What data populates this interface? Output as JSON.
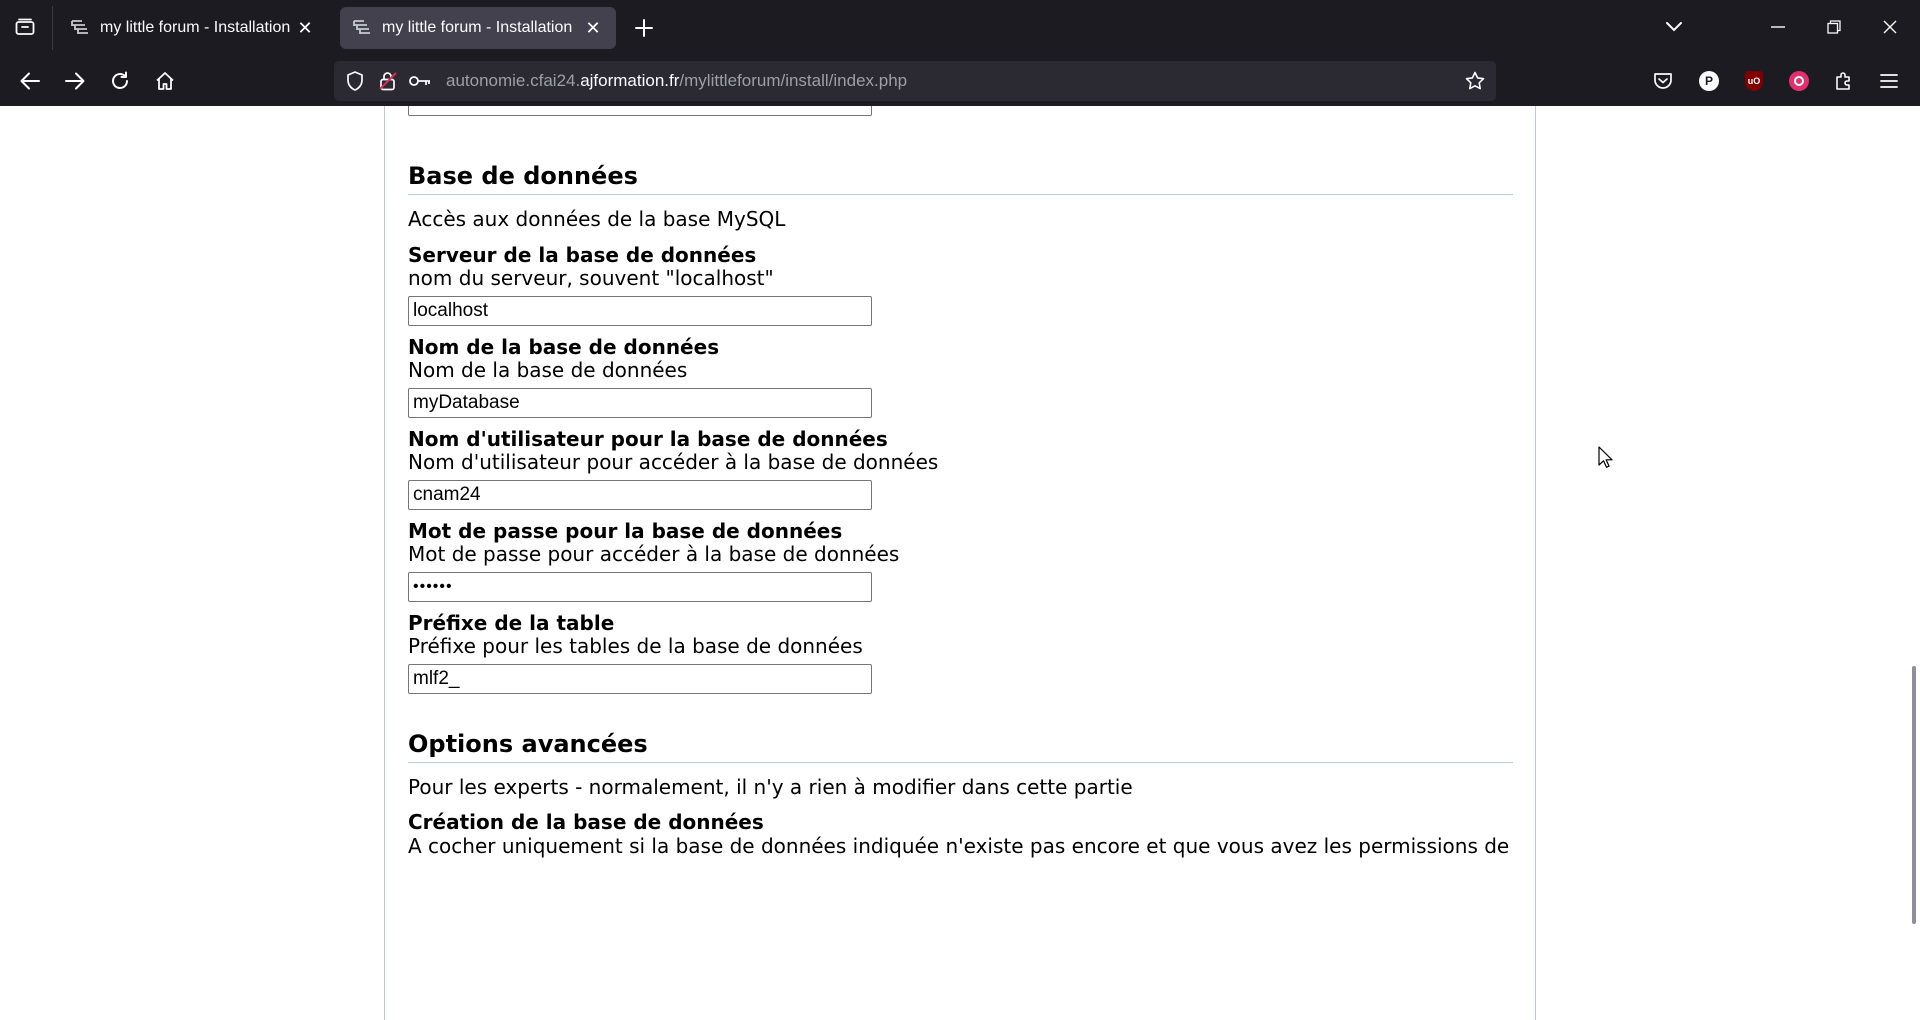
{
  "browser": {
    "tabs": [
      {
        "title": "my little forum - Installation",
        "active": false
      },
      {
        "title": "my little forum - Installation",
        "active": true
      }
    ],
    "url": {
      "prefix": "autonomie.cfai24.",
      "domain": "ajformation.fr",
      "path": "/mylittleforum/install/index.php"
    },
    "icons": {
      "tab_list": "tab-list-icon",
      "new_tab": "plus-icon",
      "back": "arrow-left-icon",
      "forward": "arrow-right-icon",
      "reload": "reload-icon",
      "home": "home-icon",
      "shield": "shield-icon",
      "lock": "lock-icon",
      "key": "key-icon",
      "bookmark": "star-icon",
      "pocket": "pocket-icon",
      "extensions": "puzzle-icon",
      "menu": "hamburger-icon"
    },
    "extension_badges": {
      "p_badge": "P",
      "ublock_badge": "uO"
    },
    "colors": {
      "chrome_bg": "#1c1b22",
      "active_tab": "#42414d",
      "urlbar_bg": "#2b2a33",
      "rule": "#bacbd9"
    }
  },
  "page": {
    "top_field_value": "••••••",
    "database_section": {
      "heading": "Base de données",
      "intro": "Accès aux données de la base MySQL",
      "fields": [
        {
          "label": "Serveur de la base de données",
          "desc": "nom du serveur, souvent \"localhost\"",
          "value": "localhost"
        },
        {
          "label": "Nom de la base de données",
          "desc": "Nom de la base de données",
          "value": "myDatabase"
        },
        {
          "label": "Nom d'utilisateur pour la base de données",
          "desc": "Nom d'utilisateur pour accéder à la base de données",
          "value": "cnam24"
        },
        {
          "label": "Mot de passe pour la base de données",
          "desc": "Mot de passe pour accéder à la base de données",
          "value": "••••••"
        },
        {
          "label": "Préfixe de la table",
          "desc": "Préfixe pour les tables de la base de données",
          "value": "mlf2_"
        }
      ]
    },
    "advanced_section": {
      "heading": "Options avancées",
      "intro": "Pour les experts - normalement, il n'y a rien à modifier dans cette partie",
      "create_db_label": "Création de la base de données",
      "create_db_desc": "A cocher uniquement si la base de données indiquée n'existe pas encore et que vous avez les permissions de"
    }
  }
}
